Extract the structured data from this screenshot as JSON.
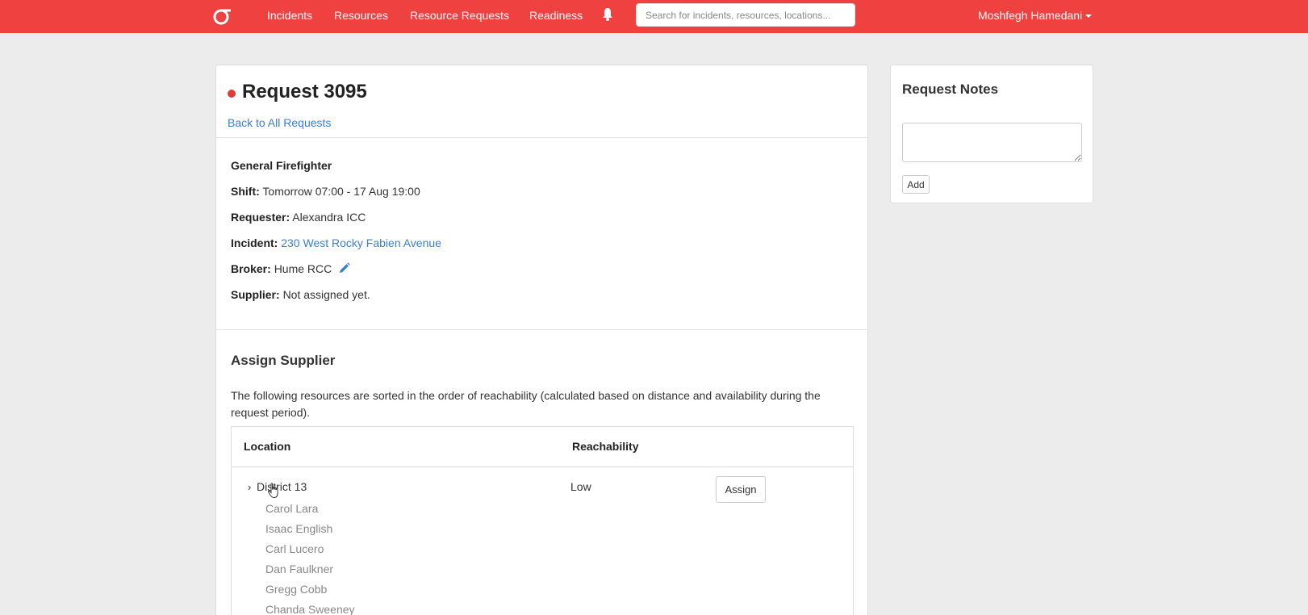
{
  "navbar": {
    "brand_icon": "sigma-logo-icon",
    "links": [
      {
        "label": "Incidents"
      },
      {
        "label": "Resources"
      },
      {
        "label": "Resource Requests"
      },
      {
        "label": "Readiness"
      }
    ],
    "notification_icon": "bell-icon",
    "search": {
      "placeholder": "Search for incidents, resources, locations...",
      "value": ""
    },
    "user": {
      "name": "Moshfegh Hamedani"
    }
  },
  "request": {
    "title": "Request 3095",
    "status_color": "#e03a3a",
    "back_link": "Back to All Requests",
    "role": "General Firefighter",
    "shift_label": "Shift:",
    "shift_value": "Tomorrow 07:00 - 17 Aug 19:00",
    "requester_label": "Requester:",
    "requester_value": "Alexandra ICC",
    "incident_label": "Incident:",
    "incident_value": "230 West Rocky Fabien Avenue",
    "broker_label": "Broker:",
    "broker_value": "Hume RCC",
    "supplier_label": "Supplier:",
    "supplier_value": "Not assigned yet."
  },
  "assign_supplier": {
    "title": "Assign Supplier",
    "intro": "The following resources are sorted in the order of reachability (calculated based on distance and availability during the request period).",
    "columns": [
      "Location",
      "Reachability"
    ],
    "rows": [
      {
        "location": "District 13",
        "reachability": "Low",
        "action": "Assign",
        "members": [
          "Carol Lara",
          "Isaac English",
          "Carl Lucero",
          "Dan Faulkner",
          "Gregg Cobb",
          "Chanda Sweeney"
        ]
      }
    ]
  },
  "notes": {
    "title": "Request Notes",
    "input_value": "",
    "add_label": "Add"
  },
  "colors": {
    "brand": "#f04141",
    "link": "#3a7fd6",
    "background": "#ececec"
  }
}
